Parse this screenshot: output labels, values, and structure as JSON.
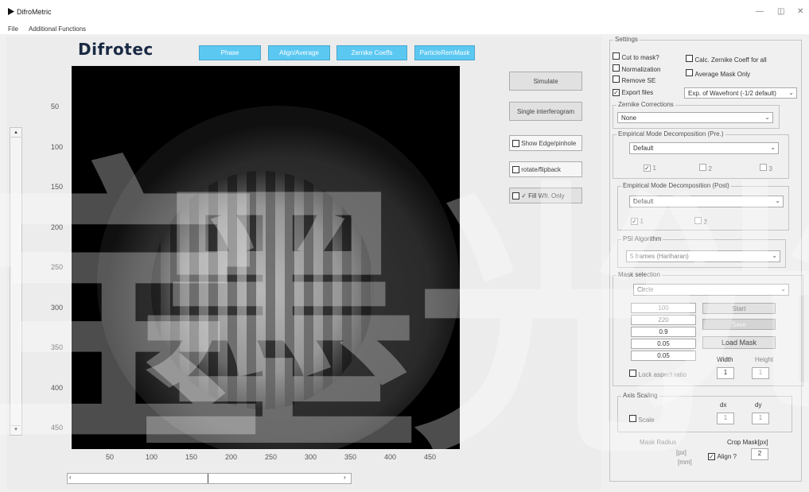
{
  "window": {
    "title": "DifroMetric",
    "controls": [
      "—",
      "◫",
      "✕"
    ]
  },
  "menu": [
    "File",
    "Additional Functions"
  ],
  "logo": "Difrotec",
  "top_buttons": [
    "Phase",
    "Align/Average",
    "Zernike Coeffs",
    "ParticleRemMask"
  ],
  "side_buttons": {
    "simulate": "Simulate",
    "single": "Single interferogram"
  },
  "side_checks": {
    "show_edge": "Show Edge/pinhole",
    "rotate": "rotate/flipback",
    "fill": "✓ Fill Wfr. Only"
  },
  "axes": {
    "y_ticks": [
      "50",
      "100",
      "150",
      "200",
      "250",
      "300",
      "350",
      "400",
      "450"
    ],
    "x_ticks": [
      "50",
      "100",
      "150",
      "200",
      "250",
      "300",
      "350",
      "400",
      "450"
    ]
  },
  "settings": {
    "title": "Settings",
    "cut_to_mask": "Cut to mask?",
    "normalization": "Normalization",
    "remove_se": "Remove SE",
    "export_files": "Export files",
    "calc_zernike": "Calc. Zernike Coeff for all",
    "average_mask": "Average Mask Only",
    "export_select": "Exp. of Wavefront (-1/2 default)",
    "zernike_title": "Zernike Corrections",
    "zernike_value": "None",
    "emd_pre_title": "Empirical Mode Decomposition (Pre.)",
    "emd_pre_value": "Default",
    "emd_pre_checks": [
      "1",
      "2",
      "3"
    ],
    "emd_post_title": "Empirical Mode Decomposition (Post)",
    "emd_post_value": "Default",
    "emd_post_checks": [
      "1",
      "2"
    ],
    "psi_title": "PSI Algorithm",
    "psi_value": "5 frames (Hariharan)",
    "mask_title": "Mask selection",
    "mask_value": "Circle",
    "mask_fields": [
      "100",
      "220",
      "0.9",
      "0.05",
      "0.05"
    ],
    "start": "Start",
    "save": "Save",
    "load_mask": "Load Mask",
    "width": "Width",
    "height": "Height",
    "width_val": "1",
    "height_val": "1",
    "lock_aspect": "Lock aspect ratio",
    "axis_title": "Axis Scaling",
    "scale": "Scale",
    "dx": "dx",
    "dy": "dy",
    "dx_val": "1",
    "dy_val": "1",
    "mask_radius": "Mask Radius",
    "crop_mask": "Crop Mask[px]",
    "px": "[px]",
    "mm": "[mm]",
    "align": "Align ?",
    "crop_val": "2"
  },
  "watermark": [
    "宝",
    "墨",
    "光",
    "光"
  ]
}
